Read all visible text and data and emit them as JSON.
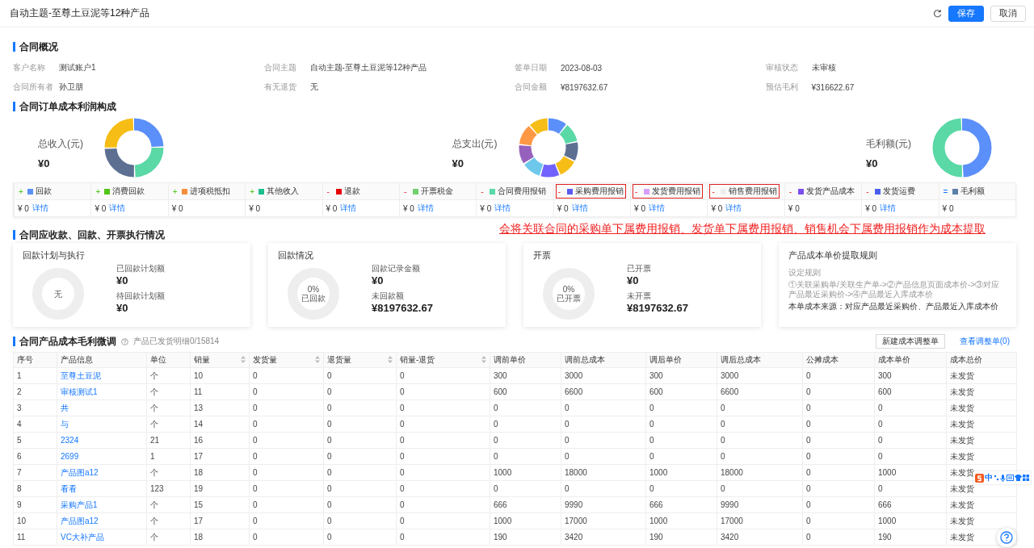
{
  "header": {
    "title": "自动主题-至尊土豆泥等12种产品",
    "buttons": [
      {
        "label": "保存",
        "kind": "primary"
      },
      {
        "label": "取消",
        "kind": "default"
      }
    ]
  },
  "overview": {
    "title": "合同概况",
    "fields": [
      {
        "label": "客户名称",
        "value": "测试账户1"
      },
      {
        "label": "合同主题",
        "value": "自动主题-至尊土豆泥等12种产品"
      },
      {
        "label": "签单日期",
        "value": "2023-08-03"
      },
      {
        "label": "审核状态",
        "value": "未审核"
      },
      {
        "label": "合同所有者",
        "value": "孙卫朋"
      },
      {
        "label": "有无退货",
        "value": "无"
      },
      {
        "label": "合同金额",
        "value": "¥8197632.67"
      },
      {
        "label": "预估毛利",
        "value": "¥316622.67"
      }
    ]
  },
  "composition": {
    "title": "合同订单成本利润构成",
    "summaries": [
      {
        "label": "总收入(元)",
        "value": "¥0"
      },
      {
        "label": "总支出(元)",
        "value": "¥0"
      },
      {
        "label": "毛利额(元)",
        "value": "¥0"
      }
    ],
    "legend": [
      {
        "sign": "+",
        "color": "#5b8ff9",
        "label": "回款",
        "value": "¥ 0",
        "link": "详情",
        "highlighted": false
      },
      {
        "sign": "+",
        "color": "#52c41a",
        "label": "消费回款",
        "value": "¥ 0",
        "link": "详情",
        "highlighted": false
      },
      {
        "sign": "+",
        "color": "#f6903d",
        "label": "进项税抵扣",
        "value": "¥ 0",
        "highlighted": false
      },
      {
        "sign": "+",
        "color": "#1fbe8c",
        "label": "其他收入",
        "value": "¥ 0",
        "highlighted": false
      },
      {
        "sign": "-",
        "color": "#e8000b",
        "label": "退款",
        "value": "¥ 0",
        "link": "详情",
        "highlighted": false
      },
      {
        "sign": "-",
        "color": "#73d06f",
        "label": "开票税金",
        "value": "¥ 0",
        "link": "详情",
        "highlighted": false
      },
      {
        "sign": "-",
        "color": "#5ad8a6",
        "label": "合同费用报销",
        "value": "¥ 0",
        "link": "详情",
        "highlighted": false
      },
      {
        "sign": "-",
        "color": "#5b5bf0",
        "label": "采购费用报销",
        "value": "¥ 0",
        "link": "详情",
        "highlighted": true
      },
      {
        "sign": "-",
        "color": "#d89ef5",
        "label": "发货费用报销",
        "value": "¥ 0",
        "link": "详情",
        "highlighted": true
      },
      {
        "sign": "-",
        "color": "#eeeeee",
        "label": "销售费用报销",
        "value": "¥ 0",
        "link": "详情",
        "highlighted": true
      },
      {
        "sign": "-",
        "color": "#7b4ff0",
        "label": "发货产品成本",
        "value": "¥ 0",
        "highlighted": false
      },
      {
        "sign": "-",
        "color": "#4a5ff0",
        "label": "发货运费",
        "value": "¥ 0",
        "link": "详情",
        "highlighted": false
      },
      {
        "sign": "=",
        "color": "#5b7fa8",
        "label": "毛利额",
        "value": "¥ 0",
        "highlighted": false
      }
    ]
  },
  "annotation": "会将关联合同的采购单下属费用报销、发货单下属费用报销、销售机会下属费用报销作为成本提取",
  "execution": {
    "title": "合同应收款、回款、开票执行情况",
    "cards": [
      {
        "kind": "donut",
        "title": "回款计划与执行",
        "center": [
          "无"
        ],
        "stats": [
          {
            "label": "已回款计划额",
            "value": "¥0"
          },
          {
            "label": "待回款计划额",
            "value": "¥0"
          }
        ]
      },
      {
        "kind": "donut",
        "title": "回款情况",
        "center": [
          "0%",
          "已回款"
        ],
        "stats": [
          {
            "label": "回款记录金额",
            "value": "¥0"
          },
          {
            "label": "未回款额",
            "value": "¥8197632.67"
          }
        ]
      },
      {
        "kind": "donut",
        "title": "开票",
        "center": [
          "0%",
          "已开票"
        ],
        "stats": [
          {
            "label": "已开票",
            "value": "¥0"
          },
          {
            "label": "未开票",
            "value": "¥8197632.67"
          }
        ]
      },
      {
        "kind": "rules",
        "title": "产品成本单价提取规则",
        "lines": [
          "设定规则",
          "①关联采购单/关联生产单->②产品信息页面成本价->③对应产品最近采购价->④产品最近入库成本价",
          "本单成本来源：对应产品最近采购价、产品最近入库成本价"
        ]
      }
    ]
  },
  "products": {
    "title": "合同产品成本毛利微调",
    "count_text": "产品已发货明细0/15814",
    "buttons": [
      {
        "label": "新建成本调整单",
        "kind": "outline"
      },
      {
        "label": "查看调整单(0)",
        "kind": "link"
      }
    ],
    "columns": [
      {
        "label": "序号",
        "sortable": false
      },
      {
        "label": "产品信息",
        "sortable": false
      },
      {
        "label": "单位",
        "sortable": false
      },
      {
        "label": "销量",
        "sortable": true
      },
      {
        "label": "发货量",
        "sortable": true
      },
      {
        "label": "退货量",
        "sortable": true
      },
      {
        "label": "销量-退货",
        "sortable": true
      },
      {
        "label": "调前单价",
        "sortable": false
      },
      {
        "label": "调前总成本",
        "sortable": false
      },
      {
        "label": "调后单价",
        "sortable": false
      },
      {
        "label": "调后总成本",
        "sortable": false
      },
      {
        "label": "公摊成本",
        "sortable": false
      },
      {
        "label": "成本单价",
        "sortable": false
      },
      {
        "label": "成本总价",
        "sortable": false
      }
    ],
    "rows": [
      [
        "1",
        "至尊土豆泥",
        "个",
        "10",
        "0",
        "0",
        "0",
        "300",
        "3000",
        "300",
        "3000",
        "0",
        "300",
        "未发货"
      ],
      [
        "2",
        "审核测试1",
        "个",
        "11",
        "0",
        "0",
        "0",
        "600",
        "6600",
        "600",
        "6600",
        "0",
        "600",
        "未发货"
      ],
      [
        "3",
        "共",
        "个",
        "13",
        "0",
        "0",
        "0",
        "0",
        "0",
        "0",
        "0",
        "0",
        "0",
        "未发货"
      ],
      [
        "4",
        "与",
        "个",
        "14",
        "0",
        "0",
        "0",
        "0",
        "0",
        "0",
        "0",
        "0",
        "0",
        "未发货"
      ],
      [
        "5",
        "2324",
        "21",
        "16",
        "0",
        "0",
        "0",
        "0",
        "0",
        "0",
        "0",
        "0",
        "0",
        "未发货"
      ],
      [
        "6",
        "2699",
        "1",
        "17",
        "0",
        "0",
        "0",
        "0",
        "0",
        "0",
        "0",
        "0",
        "0",
        "未发货"
      ],
      [
        "7",
        "产品图a12",
        "个",
        "18",
        "0",
        "0",
        "0",
        "1000",
        "18000",
        "1000",
        "18000",
        "0",
        "1000",
        "未发货"
      ],
      [
        "8",
        "看看",
        "123",
        "19",
        "0",
        "0",
        "0",
        "0",
        "0",
        "0",
        "0",
        "0",
        "0",
        "未发货"
      ],
      [
        "9",
        "采购产品1",
        "个",
        "15",
        "0",
        "0",
        "0",
        "666",
        "9990",
        "666",
        "9990",
        "0",
        "666",
        "未发货"
      ],
      [
        "10",
        "产品图a12",
        "个",
        "17",
        "0",
        "0",
        "0",
        "1000",
        "17000",
        "1000",
        "17000",
        "0",
        "1000",
        "未发货"
      ],
      [
        "11",
        "VC大补产品",
        "个",
        "18",
        "0",
        "0",
        "0",
        "190",
        "3420",
        "190",
        "3420",
        "0",
        "190",
        "未发货"
      ]
    ]
  },
  "ime": {
    "label": "中"
  }
}
